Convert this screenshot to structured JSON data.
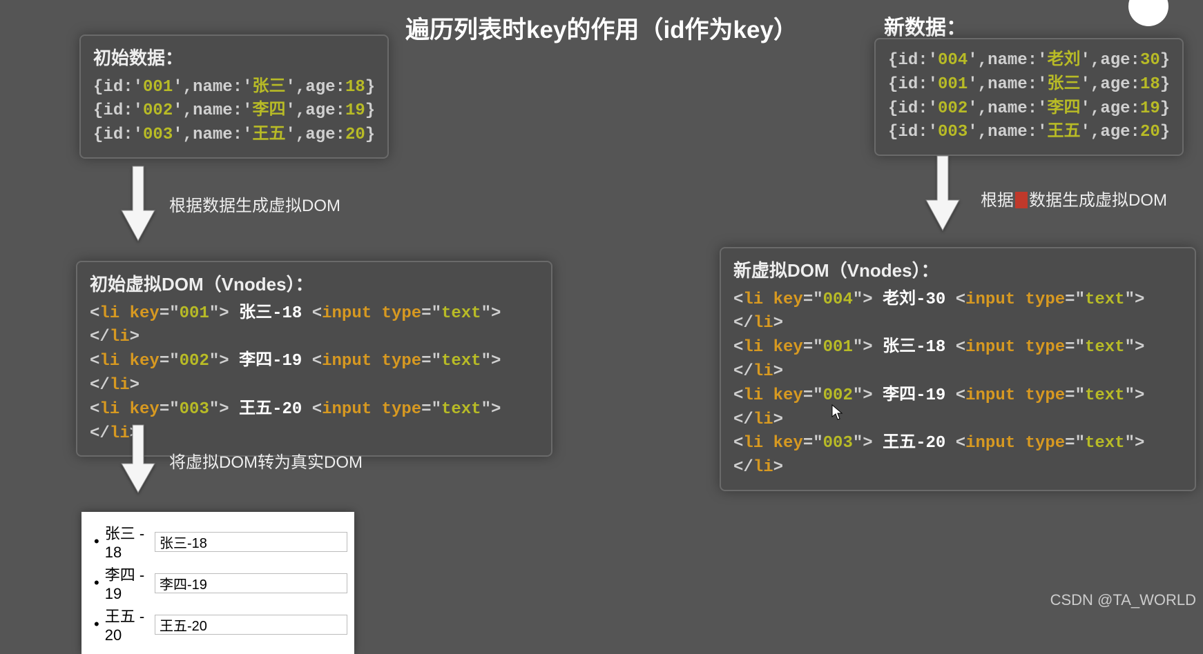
{
  "title": "遍历列表时key的作用（id作为key）",
  "initial": {
    "header": "初始数据：",
    "rows": [
      "{id:'001',name:'张三',age:18}",
      "{id:'002',name:'李四',age:19}",
      "{id:'003',name:'王五',age:20}"
    ]
  },
  "newdata": {
    "header": "新数据：",
    "rows": [
      "{id:'004',name:'老刘',age:30}",
      "{id:'001',name:'张三',age:18}",
      "{id:'002',name:'李四',age:19}",
      "{id:'003',name:'王五',age:20}"
    ]
  },
  "arrow1_label": "根据数据生成虚拟DOM",
  "arrow2_label_pre": "根据",
  "arrow2_label_post": "数据生成虚拟DOM",
  "vnodes_initial": {
    "header": "初始虚拟DOM（Vnodes）：",
    "items": [
      {
        "key": "001",
        "text": "张三-18"
      },
      {
        "key": "002",
        "text": "李四-19"
      },
      {
        "key": "003",
        "text": "王五-20"
      }
    ]
  },
  "vnodes_new": {
    "header": "新虚拟DOM（Vnodes）：",
    "items": [
      {
        "key": "004",
        "text": "老刘-30"
      },
      {
        "key": "001",
        "text": "张三-18"
      },
      {
        "key": "002",
        "text": "李四-19"
      },
      {
        "key": "003",
        "text": "王五-20"
      }
    ]
  },
  "arrow3_label": "将虚拟DOM转为真实DOM",
  "real_dom": [
    {
      "label": "张三 - 18",
      "value": "张三-18"
    },
    {
      "label": "李四 - 19",
      "value": "李四-19"
    },
    {
      "label": "王五 - 20",
      "value": "王五-20"
    }
  ],
  "watermark": "CSDN @TA_WORLD"
}
